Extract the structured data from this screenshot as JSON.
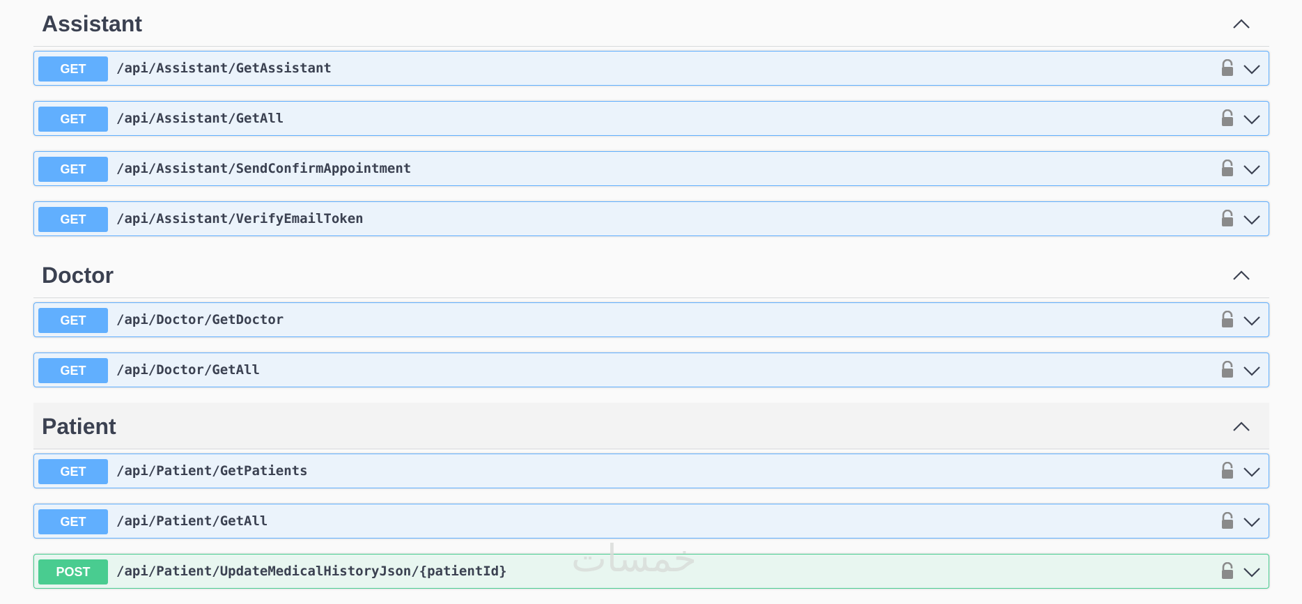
{
  "sections": [
    {
      "title": "Assistant",
      "operations": [
        {
          "method": "GET",
          "path": "/api/Assistant/GetAssistant"
        },
        {
          "method": "GET",
          "path": "/api/Assistant/GetAll"
        },
        {
          "method": "GET",
          "path": "/api/Assistant/SendConfirmAppointment"
        },
        {
          "method": "GET",
          "path": "/api/Assistant/VerifyEmailToken"
        }
      ]
    },
    {
      "title": "Doctor",
      "operations": [
        {
          "method": "GET",
          "path": "/api/Doctor/GetDoctor"
        },
        {
          "method": "GET",
          "path": "/api/Doctor/GetAll"
        }
      ]
    },
    {
      "title": "Patient",
      "operations": [
        {
          "method": "GET",
          "path": "/api/Patient/GetPatients"
        },
        {
          "method": "GET",
          "path": "/api/Patient/GetAll"
        },
        {
          "method": "POST",
          "path": "/api/Patient/UpdateMedicalHistoryJson/{patientId}"
        }
      ]
    }
  ],
  "watermark": "خمسات",
  "colors": {
    "get": "#61affe",
    "post": "#49cc90",
    "text": "#3b4151"
  },
  "icons": {
    "lock": "lock-icon",
    "expand": "chevron-down-icon",
    "collapse": "chevron-up-icon"
  }
}
